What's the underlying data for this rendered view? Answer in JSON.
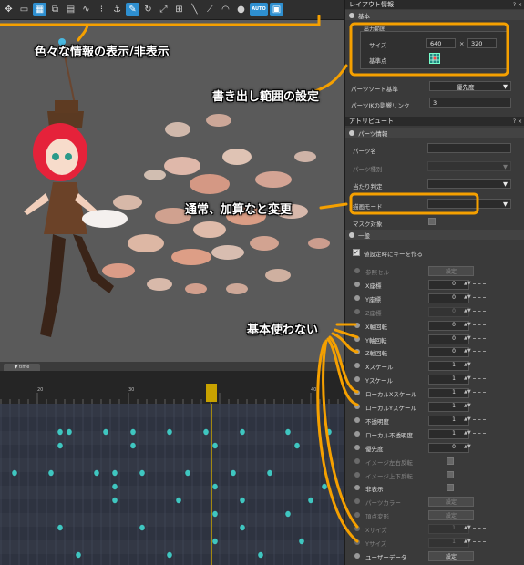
{
  "toolbar": {
    "icons": [
      "hand-icon",
      "frame-icon",
      "image-icon",
      "crop-icon",
      "trash-icon",
      "wave-icon",
      "grid-icon",
      "anchor-icon",
      "pin-icon",
      "link-icon",
      "bone-icon",
      "pen-icon",
      "stroke-icon",
      "pointer-icon",
      "ring-icon",
      "lock-icon",
      "auto-icon",
      "window-icon"
    ],
    "auto_label": "AUTO"
  },
  "viewport": {
    "annotation_info": "色々な情報の表示/非表示",
    "annotation_range": "書き出し範囲の設定",
    "annotation_blend": "通常、加算なと変更",
    "annotation_unused": "基本使わない"
  },
  "timeline": {
    "tab_label": "▼ time",
    "ruler_labels": [
      "20",
      "30",
      "40"
    ],
    "playhead_color": "#c8a200",
    "key_color": "#3fc6c0"
  },
  "panel": {
    "layout_title": "レイアウト情報",
    "ctrl": "? ×",
    "basic_header": "基本",
    "export_range_label": "出力範囲",
    "size_label": "サイズ",
    "size_w": "640",
    "size_sep": "×",
    "size_h": "320",
    "origin_label": "基準点",
    "parts_sort_label": "パーツソート基準",
    "parts_sort_value": "優先度",
    "ik_label": "パーツIKの影響リンク",
    "ik_value": "3",
    "attribute_title": "アトリビュート",
    "parts_info_header": "パーツ情報",
    "parts_name_label": "パーツ名",
    "parts_type_label": "パーツ種別",
    "hit_label": "当たり判定",
    "blend_label": "描画モード",
    "mask_label": "マスク対象",
    "general_header": "一般",
    "auto_key_label": "値設定時にキーを作る",
    "attrs": [
      {
        "name": "参照セル",
        "value": "設定",
        "kind": "button",
        "dim": true
      },
      {
        "name": "X座標",
        "value": "0",
        "kind": "num",
        "dim": false
      },
      {
        "name": "Y座標",
        "value": "0",
        "kind": "num",
        "dim": false
      },
      {
        "name": "Z座標",
        "value": "0",
        "kind": "num",
        "dim": true
      },
      {
        "name": "X軸回転",
        "value": "0",
        "kind": "num",
        "dim": false
      },
      {
        "name": "Y軸回転",
        "value": "0",
        "kind": "num",
        "dim": false
      },
      {
        "name": "Z軸回転",
        "value": "0",
        "kind": "num",
        "dim": false
      },
      {
        "name": "Xスケール",
        "value": "1",
        "kind": "num",
        "dim": false
      },
      {
        "name": "Yスケール",
        "value": "1",
        "kind": "num",
        "dim": false
      },
      {
        "name": "ローカルXスケール",
        "value": "1",
        "kind": "num",
        "dim": false
      },
      {
        "name": "ローカルYスケール",
        "value": "1",
        "kind": "num",
        "dim": false
      },
      {
        "name": "不透明度",
        "value": "1",
        "kind": "num",
        "dim": false
      },
      {
        "name": "ローカル不透明度",
        "value": "1",
        "kind": "num",
        "dim": false
      },
      {
        "name": "優先度",
        "value": "0",
        "kind": "num",
        "dim": false
      },
      {
        "name": "イメージ左右反転",
        "value": "",
        "kind": "check",
        "dim": true
      },
      {
        "name": "イメージ上下反転",
        "value": "",
        "kind": "check",
        "dim": true
      },
      {
        "name": "非表示",
        "value": "",
        "kind": "check",
        "dim": false
      },
      {
        "name": "パーツカラー",
        "value": "設定",
        "kind": "button",
        "dim": true
      },
      {
        "name": "頂点変形",
        "value": "設定",
        "kind": "button",
        "dim": true
      },
      {
        "name": "Xサイズ",
        "value": "1",
        "kind": "num",
        "dim": true
      },
      {
        "name": "Yサイズ",
        "value": "1",
        "kind": "num",
        "dim": true
      },
      {
        "name": "ユーザーデータ",
        "value": "設定",
        "kind": "button",
        "dim": false
      }
    ]
  },
  "colors": {
    "accent": "#2e8fd0",
    "annotation": "#f5a000"
  }
}
